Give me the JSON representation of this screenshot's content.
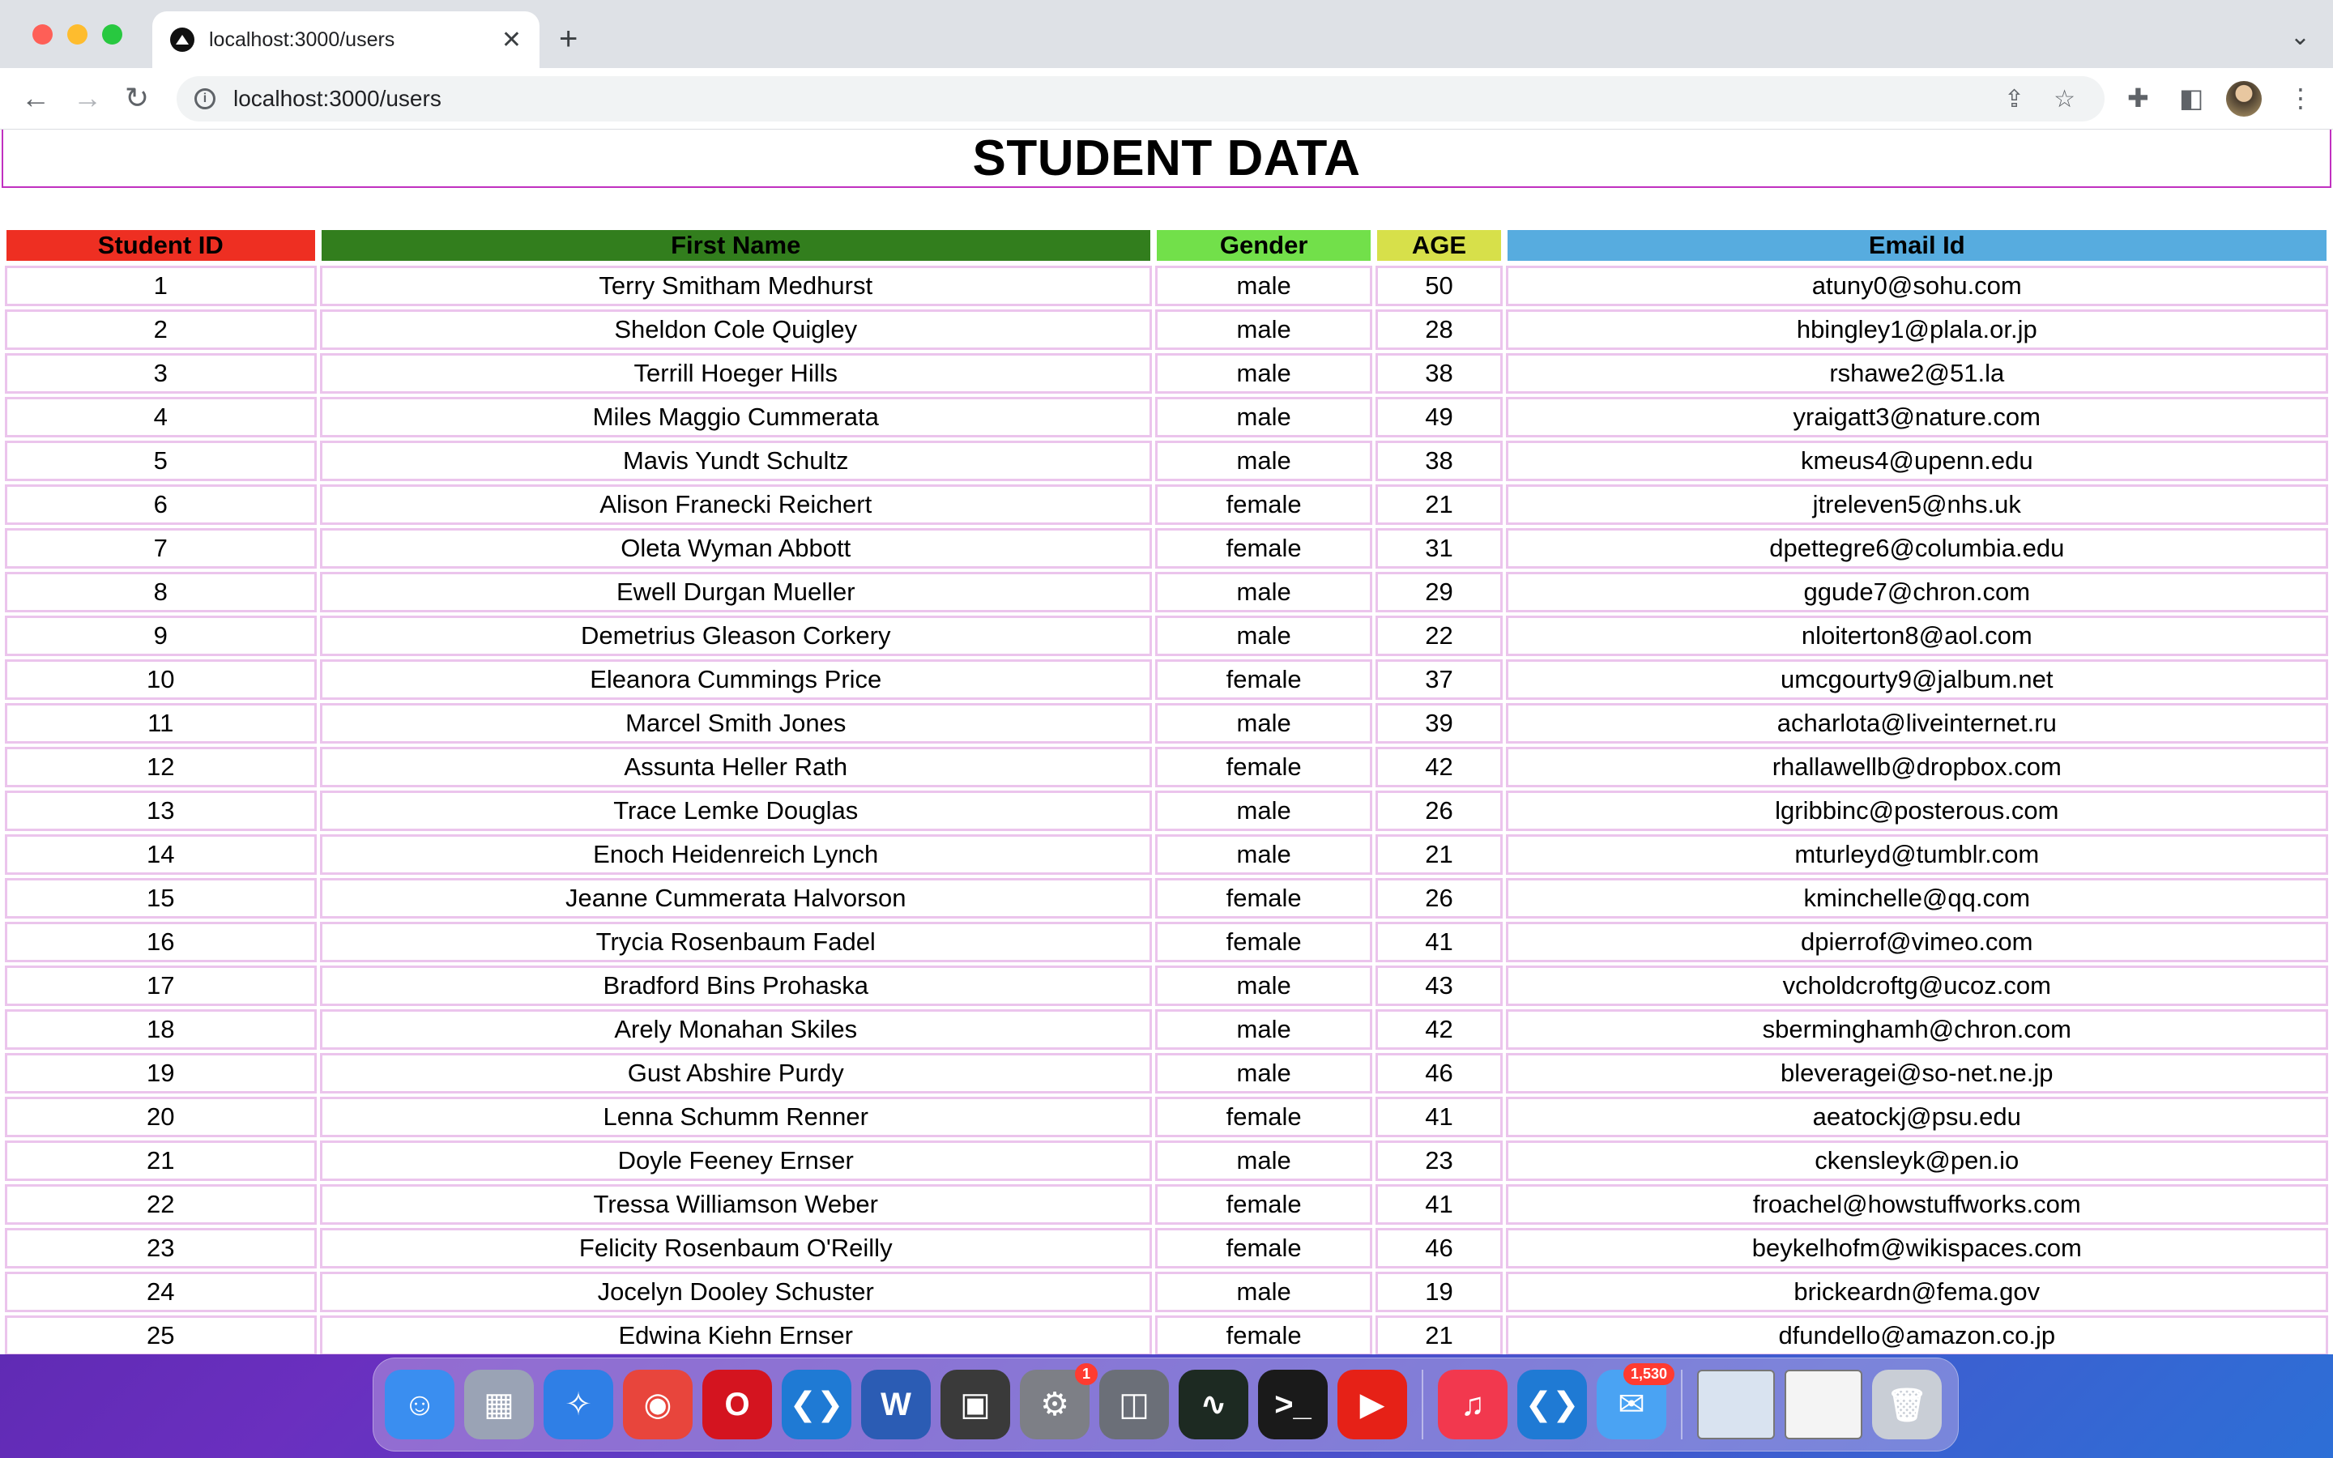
{
  "browser": {
    "tab_title": "localhost:3000/users",
    "url": "localhost:3000/users",
    "new_tab_label": "+",
    "close_tab_label": "✕"
  },
  "page": {
    "title": "STUDENT DATA"
  },
  "table": {
    "headers": [
      {
        "label": "Student ID",
        "color": "#ee2f22"
      },
      {
        "label": "First Name",
        "color": "#327e1d"
      },
      {
        "label": "Gender",
        "color": "#72e04a"
      },
      {
        "label": "AGE",
        "color": "#d7e04a"
      },
      {
        "label": "Email Id",
        "color": "#57acdf"
      }
    ],
    "rows": [
      [
        "1",
        "Terry Smitham Medhurst",
        "male",
        "50",
        "atuny0@sohu.com"
      ],
      [
        "2",
        "Sheldon Cole Quigley",
        "male",
        "28",
        "hbingley1@plala.or.jp"
      ],
      [
        "3",
        "Terrill Hoeger Hills",
        "male",
        "38",
        "rshawe2@51.la"
      ],
      [
        "4",
        "Miles Maggio Cummerata",
        "male",
        "49",
        "yraigatt3@nature.com"
      ],
      [
        "5",
        "Mavis Yundt Schultz",
        "male",
        "38",
        "kmeus4@upenn.edu"
      ],
      [
        "6",
        "Alison Franecki Reichert",
        "female",
        "21",
        "jtreleven5@nhs.uk"
      ],
      [
        "7",
        "Oleta Wyman Abbott",
        "female",
        "31",
        "dpettegre6@columbia.edu"
      ],
      [
        "8",
        "Ewell Durgan Mueller",
        "male",
        "29",
        "ggude7@chron.com"
      ],
      [
        "9",
        "Demetrius Gleason Corkery",
        "male",
        "22",
        "nloiterton8@aol.com"
      ],
      [
        "10",
        "Eleanora Cummings Price",
        "female",
        "37",
        "umcgourty9@jalbum.net"
      ],
      [
        "11",
        "Marcel Smith Jones",
        "male",
        "39",
        "acharlota@liveinternet.ru"
      ],
      [
        "12",
        "Assunta Heller Rath",
        "female",
        "42",
        "rhallawellb@dropbox.com"
      ],
      [
        "13",
        "Trace Lemke Douglas",
        "male",
        "26",
        "lgribbinc@posterous.com"
      ],
      [
        "14",
        "Enoch Heidenreich Lynch",
        "male",
        "21",
        "mturleyd@tumblr.com"
      ],
      [
        "15",
        "Jeanne Cummerata Halvorson",
        "female",
        "26",
        "kminchelle@qq.com"
      ],
      [
        "16",
        "Trycia Rosenbaum Fadel",
        "female",
        "41",
        "dpierrof@vimeo.com"
      ],
      [
        "17",
        "Bradford Bins Prohaska",
        "male",
        "43",
        "vcholdcroftg@ucoz.com"
      ],
      [
        "18",
        "Arely Monahan Skiles",
        "male",
        "42",
        "sberminghamh@chron.com"
      ],
      [
        "19",
        "Gust Abshire Purdy",
        "male",
        "46",
        "bleveragei@so-net.ne.jp"
      ],
      [
        "20",
        "Lenna Schumm Renner",
        "female",
        "41",
        "aeatockj@psu.edu"
      ],
      [
        "21",
        "Doyle Feeney Ernser",
        "male",
        "23",
        "ckensleyk@pen.io"
      ],
      [
        "22",
        "Tressa Williamson Weber",
        "female",
        "41",
        "froachel@howstuffworks.com"
      ],
      [
        "23",
        "Felicity Rosenbaum O'Reilly",
        "female",
        "46",
        "beykelhofm@wikispaces.com"
      ],
      [
        "24",
        "Jocelyn Dooley Schuster",
        "male",
        "19",
        "brickeardn@fema.gov"
      ],
      [
        "25",
        "Edwina Kiehn Ernser",
        "female",
        "21",
        "dfundello@amazon.co.jp"
      ]
    ]
  },
  "dock": {
    "items": [
      {
        "name": "finder-icon",
        "color": "#3a8ef0",
        "glyph": "☺"
      },
      {
        "name": "launchpad-icon",
        "color": "#9aa3b5",
        "glyph": "▦"
      },
      {
        "name": "safari-icon",
        "color": "#2f7fe6",
        "glyph": "✧"
      },
      {
        "name": "chrome-icon",
        "color": "#e8453c",
        "glyph": "◉"
      },
      {
        "name": "opera-icon",
        "color": "#d4141f",
        "glyph": "O"
      },
      {
        "name": "vscode-icon",
        "color": "#1f7ad4",
        "glyph": "❮❯"
      },
      {
        "name": "word-icon",
        "color": "#2b5cb4",
        "glyph": "W"
      },
      {
        "name": "final-cut-icon",
        "color": "#3a3a3a",
        "glyph": "▣"
      },
      {
        "name": "system-preferences-icon",
        "color": "#7d7f86",
        "glyph": "⚙",
        "badge": "1"
      },
      {
        "name": "screenshot-icon",
        "color": "#6b6f78",
        "glyph": "◫"
      },
      {
        "name": "activity-monitor-icon",
        "color": "#1d2a22",
        "glyph": "∿"
      },
      {
        "name": "terminal-icon",
        "color": "#1a1a1a",
        "glyph": ">_"
      },
      {
        "name": "youtube-icon",
        "color": "#e62117",
        "glyph": "▶"
      },
      {
        "name": "music-icon",
        "color": "#f2384e",
        "glyph": "♫"
      },
      {
        "name": "vscode-2-icon",
        "color": "#1f7ad4",
        "glyph": "❮❯"
      },
      {
        "name": "mail-icon",
        "color": "#4aa3f3",
        "glyph": "✉",
        "badge": "1,530"
      },
      {
        "name": "preview-window-icon",
        "color": "#d9e3f0",
        "glyph": ""
      },
      {
        "name": "window-thumbnail-icon",
        "color": "#f4f4f4",
        "glyph": ""
      },
      {
        "name": "trash-icon",
        "color": "#c9ced6",
        "glyph": "🗑"
      }
    ]
  }
}
